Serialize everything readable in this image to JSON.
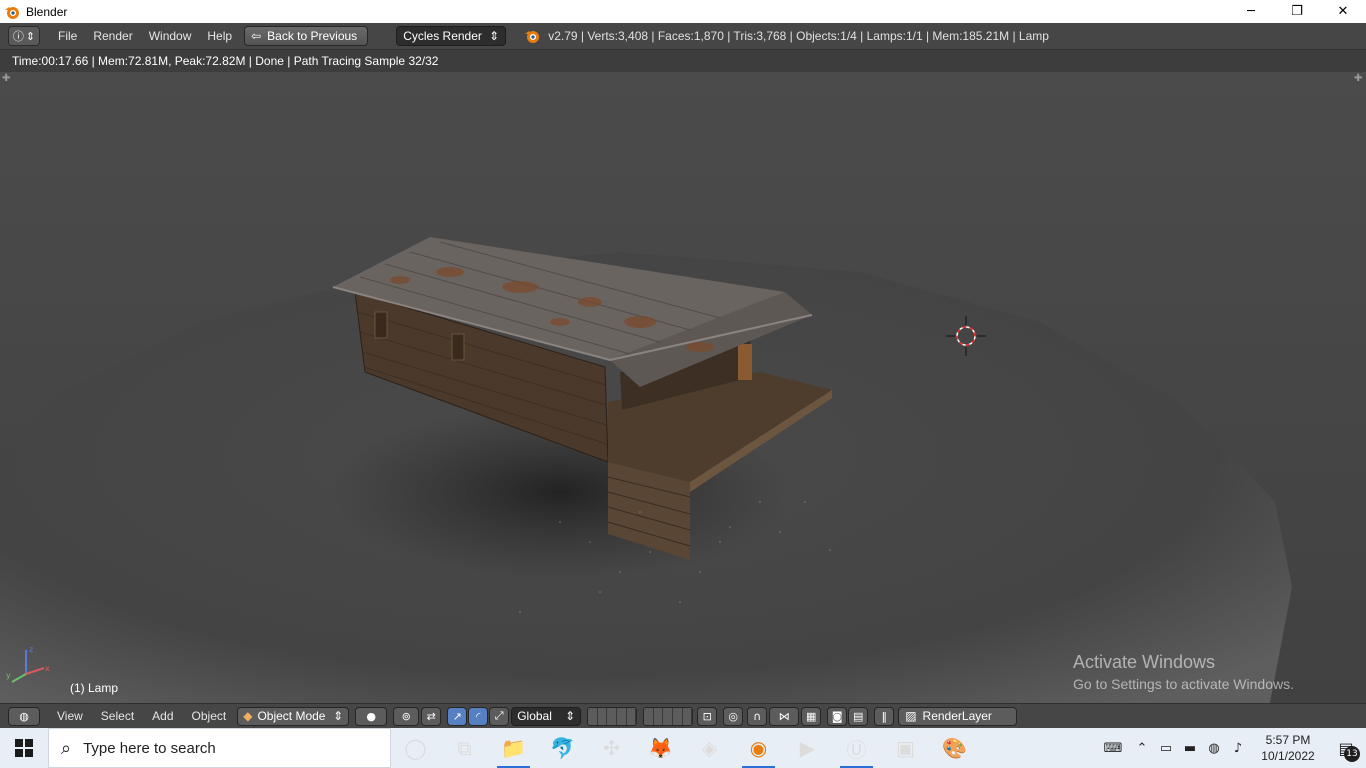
{
  "window": {
    "title": "Blender",
    "minimize_glyph": "─",
    "restore_glyph": "❐",
    "close_glyph": "✕"
  },
  "info_header": {
    "menus": [
      "File",
      "Render",
      "Window",
      "Help"
    ],
    "back_button": "Back to Previous",
    "render_engine": "Cycles Render",
    "stats": "v2.79 | Verts:3,408 | Faces:1,870 | Tris:3,768 | Objects:1/4 | Lamps:1/1 | Mem:185.21M | Lamp"
  },
  "render_info": "Time:00:17.66 | Mem:72.81M, Peak:72.82M | Done | Path Tracing Sample 32/32",
  "viewport": {
    "active_object_label": "(1) Lamp",
    "watermark_title": "Activate Windows",
    "watermark_subtitle": "Go to Settings to activate Windows."
  },
  "view_header": {
    "menus": [
      "View",
      "Select",
      "Add",
      "Object"
    ],
    "mode": "Object Mode",
    "orientation": "Global",
    "render_layer": "RenderLayer"
  },
  "taskbar": {
    "search_placeholder": "Type here to search",
    "apps": [
      {
        "name": "cortana-icon",
        "glyph": "◯"
      },
      {
        "name": "task-view-icon",
        "glyph": "⧉"
      },
      {
        "name": "file-explorer-icon",
        "glyph": "📁"
      },
      {
        "name": "dolphin-app-icon",
        "glyph": "🐬"
      },
      {
        "name": "network-app-icon",
        "glyph": "✣"
      },
      {
        "name": "firefox-icon",
        "glyph": "🦊"
      },
      {
        "name": "package-app-icon",
        "glyph": "◈"
      },
      {
        "name": "blender-taskbar-icon",
        "glyph": "◉"
      },
      {
        "name": "video-app-icon",
        "glyph": "▶"
      },
      {
        "name": "unreal-engine-icon",
        "glyph": "Ⓤ"
      },
      {
        "name": "launcher-app-icon",
        "glyph": "▣"
      },
      {
        "name": "paint-app-icon",
        "glyph": "🎨"
      }
    ],
    "time": "5:57 PM",
    "date": "10/1/2022",
    "notification_count": "13"
  },
  "colors": {
    "viewport_bg": "#474747",
    "header_bg": "#464646",
    "accent_blue": "#5680c2",
    "blender_orange": "#e87d0d"
  }
}
